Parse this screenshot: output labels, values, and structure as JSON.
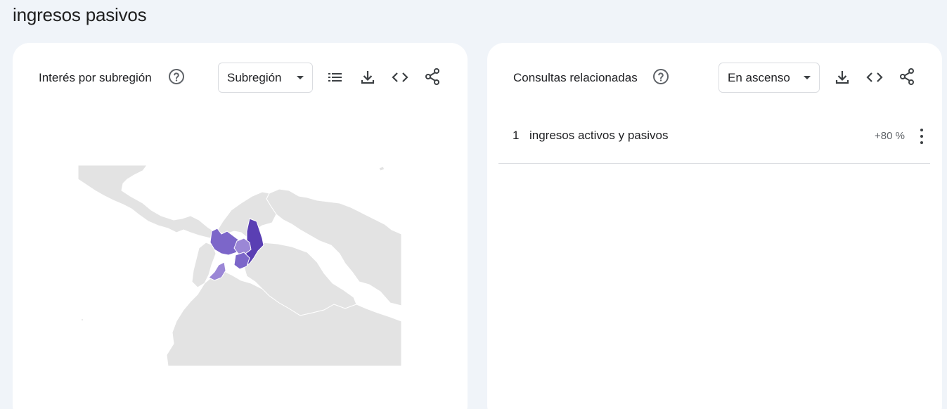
{
  "page": {
    "title": "ingresos pasivos"
  },
  "subregion_card": {
    "title": "Interés por subregión",
    "select_value": "Subregión",
    "icons": [
      "help-icon",
      "list-icon",
      "download-icon",
      "embed-icon",
      "share-icon"
    ],
    "colors": {
      "light": "#9b87d6",
      "medium": "#7c66c9",
      "dark": "#5a3fb3",
      "land": "#e3e3e3"
    }
  },
  "related_card": {
    "title": "Consultas relacionadas",
    "select_value": "En ascenso",
    "icons": [
      "help-icon",
      "download-icon",
      "embed-icon",
      "share-icon"
    ],
    "rows": [
      {
        "index": "1",
        "label": "ingresos activos y pasivos",
        "value": "+80 %"
      }
    ]
  }
}
